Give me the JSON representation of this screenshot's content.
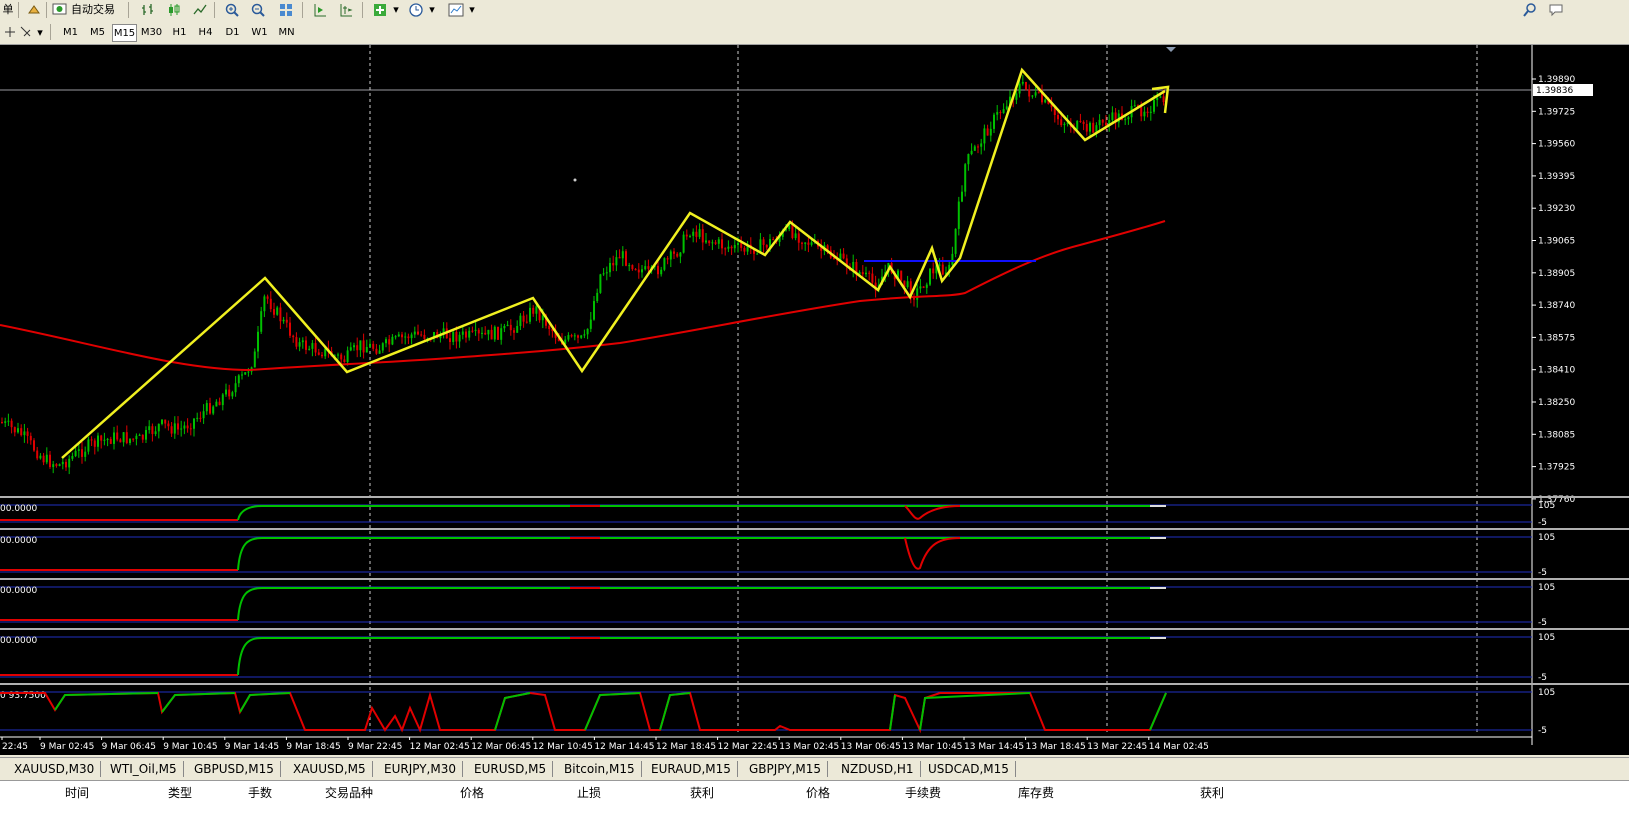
{
  "toolbar": {
    "autotrading_label": "自动交易",
    "left_label": "单"
  },
  "timeframes": [
    "M1",
    "M5",
    "M15",
    "M30",
    "H1",
    "H4",
    "D1",
    "W1",
    "MN"
  ],
  "active_timeframe": "M15",
  "colors": {
    "background": "#000000",
    "bull": "#00c000",
    "bear": "#e00000",
    "ma": "#e00000",
    "drawing": "#f0f020",
    "level_line": "#1010ff"
  },
  "price_axis": {
    "ticks": [
      "1.39890",
      "1.39725",
      "1.39560",
      "1.39395",
      "1.39230",
      "1.39065",
      "1.38905",
      "1.38740",
      "1.38575",
      "1.38410",
      "1.38250",
      "1.38085",
      "1.37925",
      "1.37760"
    ],
    "current": "1.39836"
  },
  "time_axis": [
    "22:45",
    "9 Mar 02:45",
    "9 Mar 06:45",
    "9 Mar 10:45",
    "9 Mar 14:45",
    "9 Mar 18:45",
    "9 Mar 22:45",
    "12 Mar 02:45",
    "12 Mar 06:45",
    "12 Mar 10:45",
    "12 Mar 14:45",
    "12 Mar 18:45",
    "12 Mar 22:45",
    "13 Mar 02:45",
    "13 Mar 06:45",
    "13 Mar 10:45",
    "13 Mar 14:45",
    "13 Mar 18:45",
    "13 Mar 22:45",
    "14 Mar 02:45"
  ],
  "indicators": [
    {
      "label": "00.0000",
      "scale_top": "105",
      "scale_bottom": "-5"
    },
    {
      "label": "00.0000",
      "scale_top": "105",
      "scale_bottom": "-5"
    },
    {
      "label": "00.0000",
      "scale_top": "105",
      "scale_bottom": "-5"
    },
    {
      "label": "00.0000",
      "scale_top": "105",
      "scale_bottom": "-5"
    },
    {
      "label": "0 93.7500",
      "scale_top": "105",
      "scale_bottom": "-5"
    }
  ],
  "symbol_tabs": [
    "XAUUSD,M30",
    "WTI_Oil,M5",
    "GBPUSD,M15",
    "XAUUSD,M5",
    "EURJPY,M30",
    "EURUSD,M5",
    "Bitcoin,M15",
    "EURAUD,M15",
    "GBPJPY,M15",
    "NZDUSD,H1",
    "USDCAD,M15"
  ],
  "terminal_columns": [
    "时间",
    "类型",
    "手数",
    "交易品种",
    "价格",
    "止损",
    "获利",
    "价格",
    "手续费",
    "库存费",
    "获利"
  ]
}
